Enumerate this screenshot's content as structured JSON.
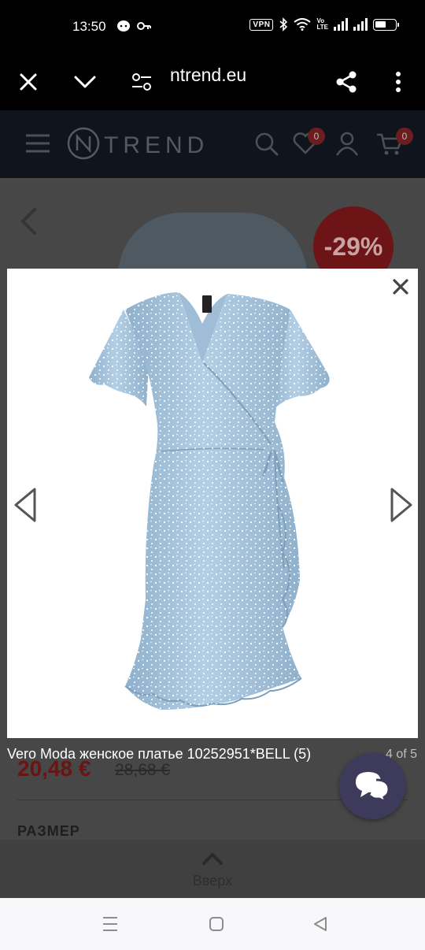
{
  "status_bar": {
    "time": "13:50",
    "vpn": "VPN",
    "volte_top": "Vo",
    "volte_bottom": "LTE",
    "icons": [
      "chat-bubble-icon",
      "key-icon",
      "bluetooth-icon",
      "wifi-icon",
      "signal-icon",
      "signal-icon",
      "battery-icon"
    ],
    "battery_level": 0.6
  },
  "browser": {
    "url": "ntrend.eu",
    "icons": [
      "close-icon",
      "chevron-down-icon",
      "site-settings-icon",
      "share-icon",
      "more-vert-icon"
    ]
  },
  "site_header": {
    "logo_text": "TREND",
    "wishlist_count": "0",
    "cart_count": "0",
    "icons": [
      "hamburger-menu-icon",
      "logo-n-icon",
      "search-icon",
      "heart-icon",
      "user-icon",
      "cart-icon"
    ]
  },
  "product": {
    "discount": "-29%",
    "price": "20,48 €",
    "old_price": "28,68 €",
    "size_label": "РАЗМЕР"
  },
  "scroll_top": {
    "label": "Вверх"
  },
  "lightbox": {
    "caption": "Vero Moda женское платье 10252951*BELL (5)",
    "counter": "4 of 5",
    "image_alt": "light blue polka-dot wrap dress"
  },
  "colors": {
    "dress": "#a9c6de",
    "dots": "#ffffff",
    "discount_red": "#c8282d",
    "chat_button": "#3e3a5c"
  }
}
